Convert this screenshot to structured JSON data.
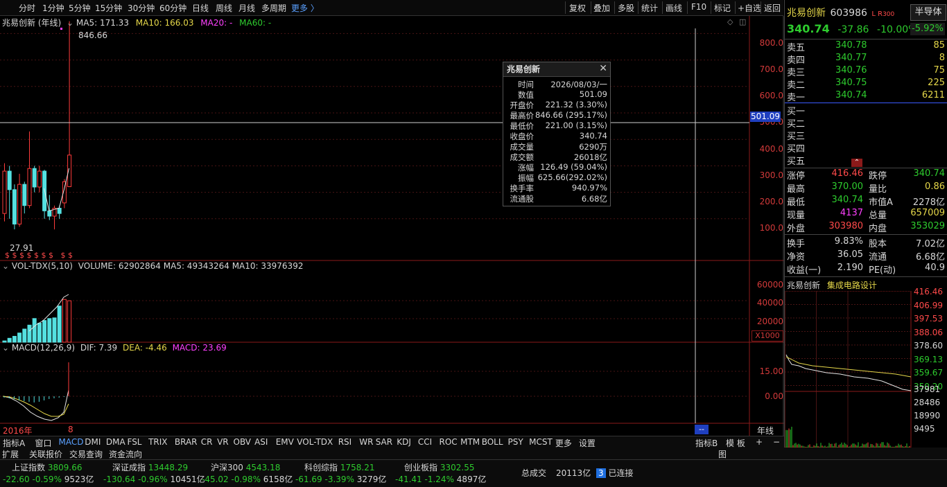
{
  "toolbar": {
    "periods": [
      "分时",
      "1分钟",
      "5分钟",
      "15分钟",
      "30分钟",
      "60分钟",
      "日线",
      "周线",
      "月线",
      "多周期",
      "更多 〉"
    ],
    "actions": [
      "复权",
      "叠加",
      "多股",
      "统计",
      "画线",
      "F10",
      "标记",
      "+自选",
      "返回"
    ]
  },
  "chart": {
    "title": "兆易创新 (年线)",
    "ma_line": {
      "ma5": "MA5: 171.33",
      "ma10": "MA10: 166.03",
      "ma20": "MA20: -",
      "ma60": "MA60: -"
    },
    "price_axis": [
      "800.0",
      "700.0",
      "600.0",
      "500.0",
      "400.0",
      "300.0",
      "200.0",
      "100.0"
    ],
    "crosshair_value": "501.09",
    "high_label": "846.66",
    "low_label": "27.91",
    "marks": "$ $ $ $ $ $ $   $ $",
    "vol_header": "VOL-TDX(5,10)",
    "vol_values": "VOLUME: 62902864  MA5: 49343264  MA10: 33976392",
    "vol_axis": [
      "60000",
      "40000",
      "20000"
    ],
    "vol_unit": "X1000",
    "macd_header": "MACD(12,26,9)",
    "macd_dif": "DIF: 7.39",
    "macd_dea": "DEA: -4.46",
    "macd_val": "MACD: 23.69",
    "macd_axis": [
      "15.00",
      "0.00"
    ],
    "year_label": "2016年",
    "year_last": "8",
    "period_label": "年线",
    "cursor_box": "--"
  },
  "chart_data": {
    "type": "candlestick",
    "candles": [
      {
        "o": 120,
        "c": 280,
        "h": 310,
        "l": 90,
        "up": true
      },
      {
        "o": 280,
        "c": 210,
        "h": 300,
        "l": 100,
        "up": false
      },
      {
        "o": 210,
        "c": 80,
        "h": 230,
        "l": 60,
        "up": false
      },
      {
        "o": 80,
        "c": 230,
        "h": 270,
        "l": 70,
        "up": true
      },
      {
        "o": 230,
        "c": 150,
        "h": 240,
        "l": 120,
        "up": false
      },
      {
        "o": 150,
        "c": 290,
        "h": 430,
        "l": 140,
        "up": true
      },
      {
        "o": 290,
        "c": 220,
        "h": 300,
        "l": 200,
        "up": false
      },
      {
        "o": 220,
        "c": 280,
        "h": 300,
        "l": 200,
        "up": true
      },
      {
        "o": 280,
        "c": 130,
        "h": 285,
        "l": 100,
        "up": false
      },
      {
        "o": 130,
        "c": 110,
        "h": 190,
        "l": 95,
        "up": false
      },
      {
        "o": 110,
        "c": 140,
        "h": 150,
        "l": 60,
        "up": true
      },
      {
        "o": 140,
        "c": 120,
        "h": 150,
        "l": 100,
        "up": false
      },
      {
        "o": 160,
        "c": 240,
        "h": 250,
        "l": 140,
        "up": true
      },
      {
        "o": 221.32,
        "c": 340.74,
        "h": 846.66,
        "l": 221.0,
        "up": true
      }
    ],
    "volume": [
      {
        "v": 2,
        "up": false
      },
      {
        "v": 6,
        "up": false
      },
      {
        "v": 9,
        "up": false
      },
      {
        "v": 14,
        "up": false
      },
      {
        "v": 20,
        "up": false
      },
      {
        "v": 26,
        "up": false
      },
      {
        "v": 36,
        "up": false
      },
      {
        "v": 29,
        "up": false
      },
      {
        "v": 33,
        "up": false
      },
      {
        "v": 36,
        "up": false
      },
      {
        "v": 37,
        "up": false
      },
      {
        "v": 55,
        "up": false
      },
      {
        "v": 65,
        "up": true
      },
      {
        "v": 63,
        "up": true
      }
    ],
    "ylim": [
      0,
      900
    ]
  },
  "infobox": {
    "title": "兆易创新",
    "rows": [
      {
        "k": "时间",
        "v": "2026/08/03/一",
        "c": "w"
      },
      {
        "k": "数值",
        "v": "501.09",
        "c": "w"
      },
      {
        "k": "开盘价",
        "v": "221.32 (3.30%)",
        "c": "r"
      },
      {
        "k": "最高价",
        "v": "846.66 (295.17%)",
        "c": "r"
      },
      {
        "k": "最低价",
        "v": "221.00 (3.15%)",
        "c": "r"
      },
      {
        "k": "收盘价",
        "v": "340.74",
        "c": "r"
      },
      {
        "k": "成交量",
        "v": "6290万",
        "c": "w"
      },
      {
        "k": "成交额",
        "v": "26018亿",
        "c": "w"
      },
      {
        "k": "涨幅",
        "v": "126.49 (59.04%)",
        "c": "r"
      },
      {
        "k": "振幅",
        "v": "625.66(292.02%)",
        "c": "w"
      },
      {
        "k": "换手率",
        "v": "940.97%",
        "c": "w"
      },
      {
        "k": "流通股",
        "v": "6.68亿",
        "c": "w"
      }
    ]
  },
  "quote": {
    "name": "兆易创新",
    "code": "603986",
    "badge": "L R",
    "badge_num": "300",
    "sector_btn": "半导体",
    "price": "340.74",
    "change": "-37.86",
    "pct": "-10.00%",
    "sector_pct": "-5.92%",
    "asks": [
      {
        "k": "卖五",
        "p": "340.78",
        "q": "85"
      },
      {
        "k": "卖四",
        "p": "340.77",
        "q": "8"
      },
      {
        "k": "卖三",
        "p": "340.76",
        "q": "75"
      },
      {
        "k": "卖二",
        "p": "340.75",
        "q": "225"
      },
      {
        "k": "卖一",
        "p": "340.74",
        "q": "6211"
      }
    ],
    "bids": [
      "买一",
      "买二",
      "买三",
      "买四",
      "买五"
    ],
    "stats": [
      {
        "k1": "涨停",
        "v1": "416.46",
        "c1": "r",
        "k2": "跌停",
        "v2": "340.74",
        "c2": "g"
      },
      {
        "k1": "最高",
        "v1": "370.00",
        "c1": "g",
        "k2": "量比",
        "v2": "0.86",
        "c2": "y"
      },
      {
        "k1": "最低",
        "v1": "340.74",
        "c1": "g",
        "k2": "市值A",
        "v2": "2278亿",
        "c2": "w"
      },
      {
        "k1": "现量",
        "v1": "4137",
        "c1": "m",
        "k2": "总量",
        "v2": "657009",
        "c2": "y"
      },
      {
        "k1": "外盘",
        "v1": "303980",
        "c1": "r",
        "k2": "内盘",
        "v2": "353029",
        "c2": "g"
      }
    ],
    "fund": [
      {
        "k1": "换手",
        "v1": "9.83%",
        "k2": "股本",
        "v2": "7.02亿"
      },
      {
        "k1": "净资",
        "v1": "36.05",
        "k2": "流通",
        "v2": "6.68亿"
      },
      {
        "k1": "收益(一)",
        "v1": "2.190",
        "k2": "PE(动)",
        "v2": "40.9"
      }
    ],
    "mini_title": "兆易创新",
    "mini_sector": "集成电路设计",
    "mini_axis": [
      "416.46",
      "406.99",
      "397.53",
      "388.06",
      "378.60",
      "369.13",
      "359.67",
      "350.20"
    ],
    "mini_vol_axis": [
      "37981",
      "28486",
      "18990",
      "9495"
    ]
  },
  "tabs": [
    "指标A",
    "窗口",
    "MACD",
    "DMI",
    "DMA",
    "FSL",
    "TRIX",
    "BRAR",
    "CR",
    "VR",
    "OBV",
    "ASI",
    "EMV",
    "VOL-TDX",
    "RSI",
    "WR",
    "SAR",
    "KDJ",
    "CCI",
    "ROC",
    "MTM",
    "BOLL",
    "PSY",
    "MCST",
    "更多",
    "设置"
  ],
  "tabs_right": [
    "指标B",
    "模 板",
    "+",
    "−"
  ],
  "row2": [
    "扩展",
    "关联报价",
    "交易查询",
    "资金流向"
  ],
  "row2_right": "图",
  "indices": [
    {
      "name": "上证指数",
      "val": "3809.66",
      "chg": "-22.60",
      "pct": "-0.59%",
      "amt": "9523亿"
    },
    {
      "name": "深证成指",
      "val": "13448.29",
      "chg": "-130.64",
      "pct": "-0.96%",
      "amt": "10451亿"
    },
    {
      "name": "沪深300",
      "val": "4543.18",
      "chg": "-45.02",
      "pct": "-0.98%",
      "amt": "6158亿"
    },
    {
      "name": "科创综指",
      "val": "1758.21",
      "chg": "-61.69",
      "pct": "-3.39%",
      "amt": "3279亿"
    },
    {
      "name": "创业板指",
      "val": "3302.55",
      "chg": "-41.41",
      "pct": "-1.24%",
      "amt": "4897亿"
    }
  ],
  "status": {
    "total_label": "总成交",
    "total": "20113亿",
    "conn_num": "3",
    "conn": "已连接"
  }
}
